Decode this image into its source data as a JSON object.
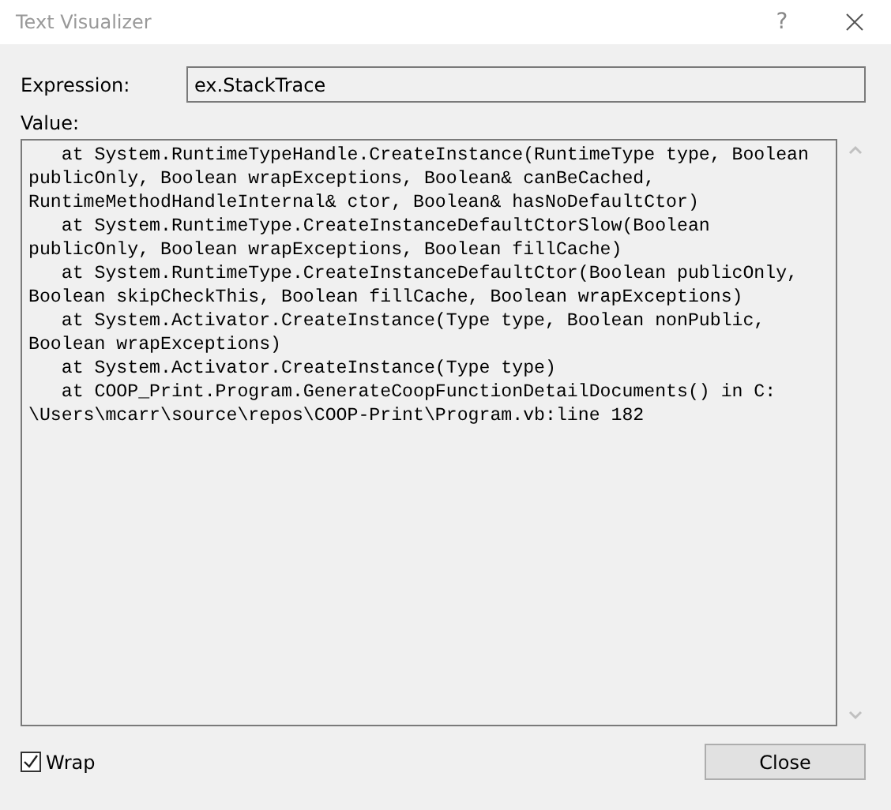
{
  "window": {
    "title": "Text Visualizer",
    "help": "?"
  },
  "expression": {
    "label": "Expression:",
    "value": "ex.StackTrace"
  },
  "value": {
    "label": "Value:",
    "lines": [
      "   at System.RuntimeTypeHandle.CreateInstance(RuntimeType type, Boolean",
      "publicOnly, Boolean wrapExceptions, Boolean& canBeCached,",
      "RuntimeMethodHandleInternal& ctor, Boolean& hasNoDefaultCtor)",
      "   at System.RuntimeType.CreateInstanceDefaultCtorSlow(Boolean",
      "publicOnly, Boolean wrapExceptions, Boolean fillCache)",
      "   at System.RuntimeType.CreateInstanceDefaultCtor(Boolean publicOnly,",
      "Boolean skipCheckThis, Boolean fillCache, Boolean wrapExceptions)",
      "   at System.Activator.CreateInstance(Type type, Boolean nonPublic,",
      "Boolean wrapExceptions)",
      "   at System.Activator.CreateInstance(Type type)",
      "   at COOP_Print.Program.GenerateCoopFunctionDetailDocuments() in C:",
      "\\Users\\mcarr\\source\\repos\\COOP-Print\\Program.vb:line 182"
    ]
  },
  "wrap": {
    "label": "Wrap",
    "checked": true
  },
  "buttons": [
    "Close"
  ]
}
